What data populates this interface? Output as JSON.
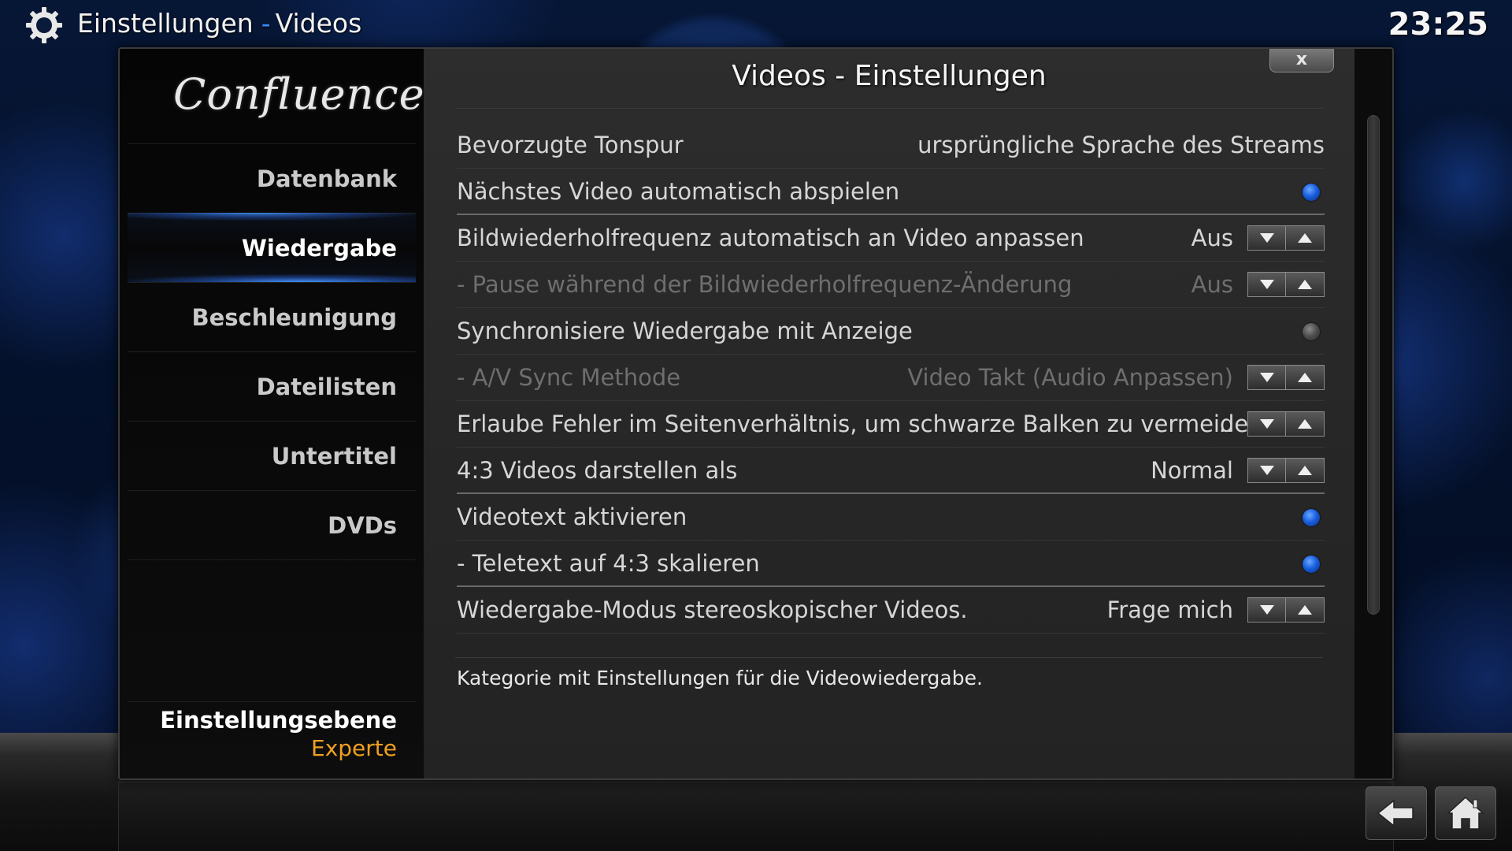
{
  "header": {
    "section": "Einstellungen",
    "separator": "-",
    "page": "Videos",
    "clock": "23:25"
  },
  "sidebar": {
    "logo": "Confluence",
    "items": [
      {
        "label": "Datenbank",
        "active": false
      },
      {
        "label": "Wiedergabe",
        "active": true
      },
      {
        "label": "Beschleunigung",
        "active": false
      },
      {
        "label": "Dateilisten",
        "active": false
      },
      {
        "label": "Untertitel",
        "active": false
      },
      {
        "label": "DVDs",
        "active": false
      }
    ],
    "settings_level_label": "Einstellungsebene",
    "settings_level_value": "Experte"
  },
  "dialog": {
    "title": "Videos - Einstellungen",
    "close_label": "x",
    "description": "Kategorie mit Einstellungen für die Videowiedergabe."
  },
  "settings": [
    {
      "label": "Bevorzugte Tonspur",
      "value": "ursprüngliche Sprache des Streams",
      "control": "text",
      "enabled": true
    },
    {
      "label": "Nächstes Video automatisch abspielen",
      "value": "",
      "control": "radio",
      "checked": true,
      "enabled": true
    },
    {
      "label": "Bildwiederholfrequenz automatisch an Video anpassen",
      "value": "Aus",
      "control": "spin",
      "enabled": true
    },
    {
      "label": "- Pause während der Bildwiederholfrequenz-Änderung",
      "value": "Aus",
      "control": "spin",
      "enabled": false
    },
    {
      "label": "Synchronisiere Wiedergabe mit Anzeige",
      "value": "",
      "control": "radio",
      "checked": false,
      "enabled": true
    },
    {
      "label": "- A/V Sync Methode",
      "value": "Video Takt (Audio Anpassen)",
      "control": "spin",
      "enabled": false
    },
    {
      "label": "Erlaube Fehler im Seitenverhältnis, um schwarze Balken zu vermeiden",
      "value": "..",
      "control": "spin",
      "enabled": true
    },
    {
      "label": "4:3 Videos darstellen als",
      "value": "Normal",
      "control": "spin",
      "enabled": true
    },
    {
      "label": "Videotext aktivieren",
      "value": "",
      "control": "radio",
      "checked": true,
      "enabled": true
    },
    {
      "label": "- Teletext auf 4:3 skalieren",
      "value": "",
      "control": "radio",
      "checked": true,
      "enabled": true
    },
    {
      "label": "Wiedergabe-Modus stereoskopischer Videos.",
      "value": "Frage mich",
      "control": "spin",
      "enabled": true
    }
  ],
  "colors": {
    "accent": "#3a8cff",
    "level_value": "#f0a020",
    "radio_on": "#1a60e0"
  },
  "icons": {
    "settings": "gear-icon",
    "back": "back-arrow-icon",
    "home": "home-icon",
    "spin_down": "arrow-down-icon",
    "spin_up": "arrow-up-icon"
  }
}
